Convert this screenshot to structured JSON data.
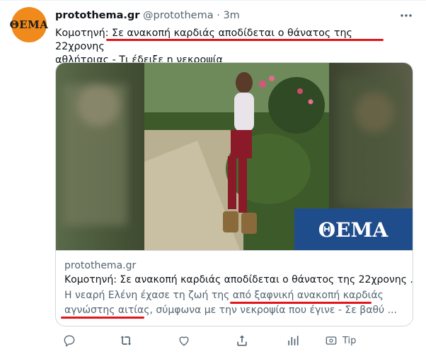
{
  "tweet": {
    "avatar_text": "ΘΕΜΑ",
    "name": "protothema.gr",
    "handle": "@protothema",
    "separator": "·",
    "time": "3m",
    "text_line1": "Κομοτηνή: Σε ανακοπή καρδιάς αποδίδεται ο θάνατος της 22χρονης",
    "text_line2": "αθλήτριας - Τι έδειξε η νεκροψία"
  },
  "card": {
    "image_watermark": "ΘΕΜΑ",
    "domain": "protothema.gr",
    "title": "Κομοτηνή: Σε ανακοπή καρδιάς αποδίδεται ο θάνατος της 22χρονης ...",
    "description_line1": "Η νεαρή Ελένη έχασε τη ζωή της από ξαφνική ανακοπή καρδιάς",
    "description_line2": "αγνώστης αιτίας, σύμφωνα με την νεκροψία που έγινε - Σε βαθύ ..."
  },
  "actions": {
    "tip_label": "Tip"
  },
  "colors": {
    "accent_underline": "#e3141b",
    "avatar_bg": "#f08a1c",
    "watermark_bg": "#1f4d8c",
    "secondary_text": "#536471"
  }
}
